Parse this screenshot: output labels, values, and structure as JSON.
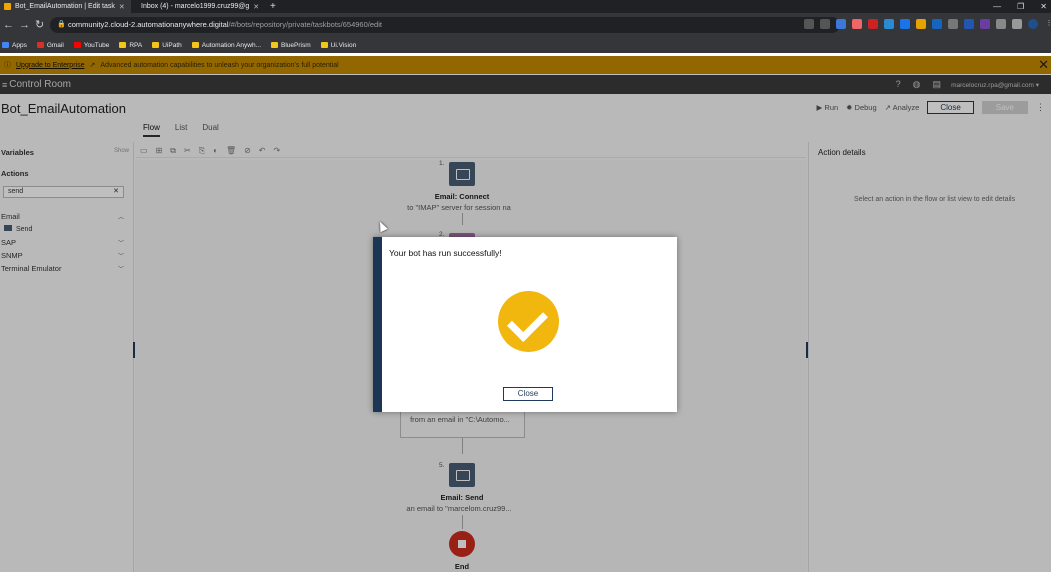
{
  "browser": {
    "tabs": [
      {
        "title": "Bot_EmailAutomation | Edit task",
        "active": true
      },
      {
        "title": "Inbox (4) - marcelo1999.cruz99@g",
        "active": false
      }
    ],
    "url_host": "community2.cloud-2.automationanywhere.digital",
    "url_path": "/#/bots/repository/private/taskbots/654960/edit",
    "bookmarks": [
      "Apps",
      "Gmail",
      "YouTube",
      "RPA",
      "UiPath",
      "Automation Anywh...",
      "BluePrism",
      "Ui.Vision"
    ]
  },
  "banner": {
    "link": "Upgrade to Enterprise",
    "text": "Advanced automation capabilities to unleash your organization's full potential"
  },
  "header": {
    "app_title": "Control Room",
    "user_email": "marcelocruz.rpa@gmail.com"
  },
  "editor": {
    "bot_name": "Bot_EmailAutomation",
    "toolbar_actions": {
      "run": "Run",
      "debug": "Debug",
      "analyze": "Analyze",
      "close": "Close",
      "save": "Save"
    },
    "view_tabs": [
      "Flow",
      "List",
      "Dual"
    ],
    "active_view": "Flow"
  },
  "left_panel": {
    "variables_label": "Variables",
    "show_label": "Show",
    "actions_label": "Actions",
    "search_value": "send",
    "groups": [
      {
        "name": "Email",
        "expanded": true,
        "items": [
          "Send"
        ]
      },
      {
        "name": "SAP",
        "expanded": false,
        "items": []
      },
      {
        "name": "SNMP",
        "expanded": false,
        "items": []
      },
      {
        "name": "Terminal Emulator",
        "expanded": false,
        "items": []
      }
    ]
  },
  "flow": {
    "nodes": [
      {
        "num": "1.",
        "title": "Email: Connect",
        "desc": "to \"IMAP\" server for session na"
      },
      {
        "num": "2.",
        "title": "",
        "desc": ""
      },
      {
        "num": "",
        "title": "",
        "desc": "from an email in \"C:\\Automo..."
      },
      {
        "num": "5.",
        "title": "Email: Send",
        "desc": "an email to \"marcelom.cruz99..."
      },
      {
        "num": "",
        "title": "End",
        "desc": ""
      }
    ]
  },
  "right_panel": {
    "title": "Action details",
    "placeholder": "Select an action in the flow or list view to edit details"
  },
  "modal": {
    "message": "Your bot has run successfully!",
    "close_label": "Close",
    "accent_color": "#1c3554",
    "icon_color": "#f2b70f"
  }
}
